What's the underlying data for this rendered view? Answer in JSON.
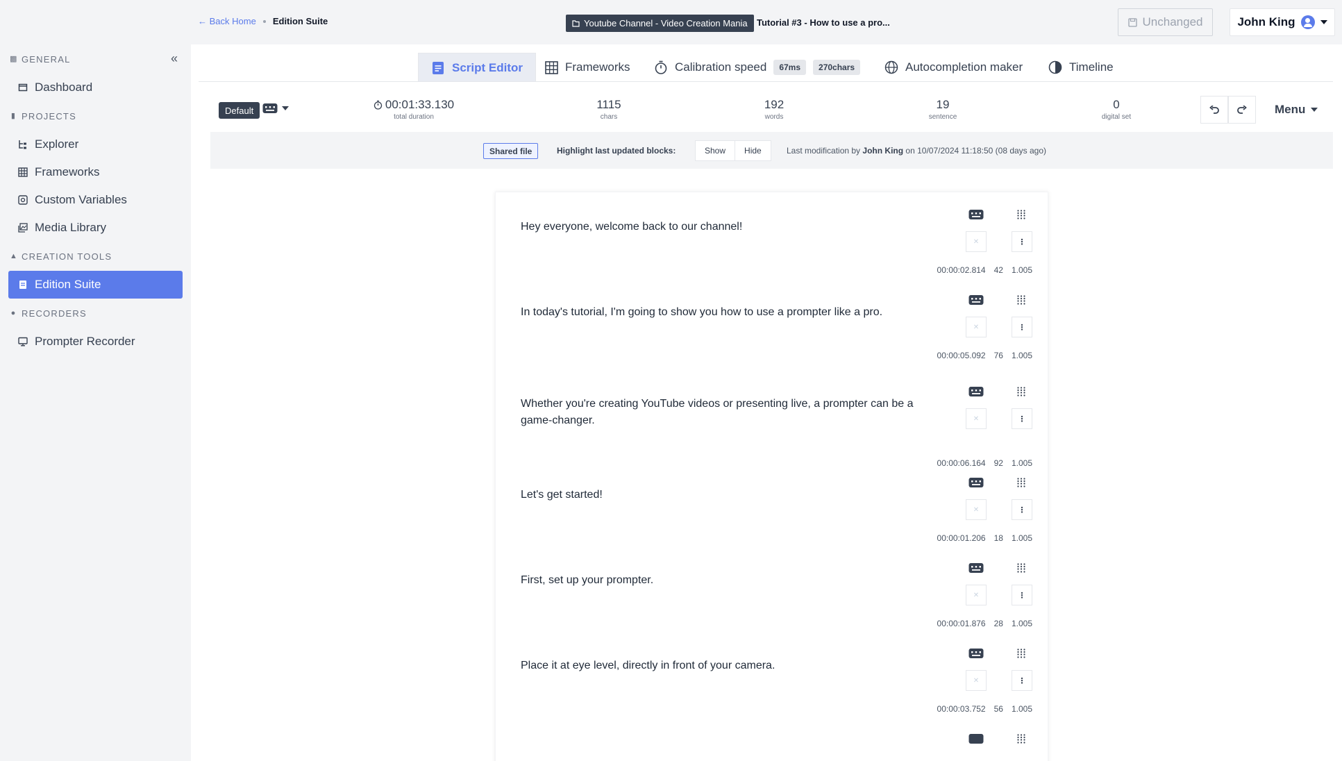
{
  "sidebar": {
    "collapse_icon": "double-chevron-left-icon",
    "sections": [
      {
        "label": "GENERAL",
        "icon": "general-icon"
      },
      {
        "label": "PROJECTS",
        "icon": "projects-icon"
      },
      {
        "label": "CREATION TOOLS",
        "icon": "tools-icon"
      },
      {
        "label": "RECORDERS",
        "icon": "record-icon"
      }
    ],
    "items": [
      {
        "label": "Dashboard",
        "icon": "dashboard-icon"
      },
      {
        "label": "Explorer",
        "icon": "tree-icon"
      },
      {
        "label": "Frameworks",
        "icon": "table-icon"
      },
      {
        "label": "Custom Variables",
        "icon": "variable-icon"
      },
      {
        "label": "Media Library",
        "icon": "images-icon"
      },
      {
        "label": "Edition Suite",
        "icon": "document-icon"
      },
      {
        "label": "Prompter Recorder",
        "icon": "monitor-icon"
      }
    ]
  },
  "topbar": {
    "back_label": "Back Home",
    "current_label": "Edition Suite",
    "channel_label": "Youtube Channel - Video Creation Mania",
    "tutorial_title": "Tutorial #3 - How to use a pro...",
    "unchanged_label": "Unchanged",
    "user_name": "John King"
  },
  "tabs": [
    {
      "label": "Script Editor",
      "active": true
    },
    {
      "label": "Frameworks"
    },
    {
      "label": "Calibration speed",
      "pill1": "67ms",
      "pill2": "270chars"
    },
    {
      "label": "Autocompletion maker"
    },
    {
      "label": "Timeline"
    }
  ],
  "stats": {
    "default_label": "Default",
    "duration": "00:01:33.130",
    "duration_label": "total duration",
    "chars": "1115",
    "chars_label": "chars",
    "words": "192",
    "words_label": "words",
    "sentence": "19",
    "sentence_label": "sentence",
    "digital": "0",
    "digital_label": "digital set",
    "menu_label": "Menu"
  },
  "infobar": {
    "shared_label": "Shared file",
    "highlight_label": "Highlight last updated blocks:",
    "show_label": "Show",
    "hide_label": "Hide",
    "lastmod_prefix": "Last modification by",
    "lastmod_user": "John King",
    "lastmod_suffix": "on 10/07/2024 11:18:50 (08 days ago)"
  },
  "blocks": [
    {
      "text": "Hey everyone, welcome back to our channel!",
      "time": "00:00:02.814",
      "chars": "42",
      "speed": "1.005"
    },
    {
      "text": "In today's tutorial, I'm going to show you how to use a prompter like a pro.",
      "time": "00:00:05.092",
      "chars": "76",
      "speed": "1.005"
    },
    {
      "text": "Whether you're creating YouTube videos or presenting live, a prompter can be a game-changer.",
      "time": "00:00:06.164",
      "chars": "92",
      "speed": "1.005"
    },
    {
      "text": "Let's get started!",
      "time": "00:00:01.206",
      "chars": "18",
      "speed": "1.005"
    },
    {
      "text": "First, set up your prompter.",
      "time": "00:00:01.876",
      "chars": "28",
      "speed": "1.005"
    },
    {
      "text": "Place it at eye level, directly in front of your camera.",
      "time": "00:00:03.752",
      "chars": "56",
      "speed": "1.005"
    }
  ],
  "colors": {
    "accent": "#5b7bea",
    "dark": "#374151",
    "sidebar_bg": "#f3f4f6"
  }
}
